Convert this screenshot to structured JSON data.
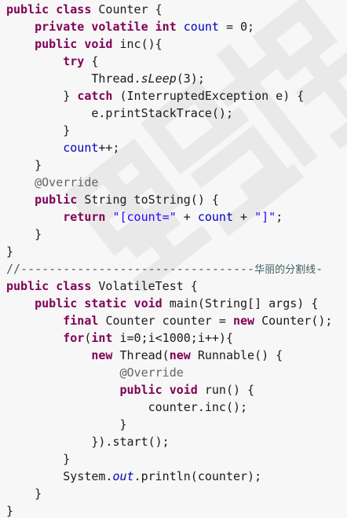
{
  "title": "",
  "watermark": "黑马程序员",
  "lines": [
    [
      {
        "t": "public class ",
        "c": "kw"
      },
      {
        "t": "Counter {"
      }
    ],
    [
      {
        "t": "    "
      },
      {
        "t": "private volatile int ",
        "c": "kw"
      },
      {
        "t": "count",
        "c": "fld"
      },
      {
        "t": " = 0;"
      }
    ],
    [
      {
        "t": "    "
      },
      {
        "t": "public void ",
        "c": "kw"
      },
      {
        "t": "inc(){"
      }
    ],
    [
      {
        "t": "        "
      },
      {
        "t": "try ",
        "c": "kw"
      },
      {
        "t": "{"
      }
    ],
    [
      {
        "t": "            Thread."
      },
      {
        "t": "sLeep",
        "c": "ital"
      },
      {
        "t": "(3);"
      }
    ],
    [
      {
        "t": "        } "
      },
      {
        "t": "catch ",
        "c": "kw"
      },
      {
        "t": "(InterruptedException e) {"
      }
    ],
    [
      {
        "t": "            e.printStackTrace();"
      }
    ],
    [
      {
        "t": "        }"
      }
    ],
    [
      {
        "t": "        "
      },
      {
        "t": "count",
        "c": "fld"
      },
      {
        "t": "++;"
      }
    ],
    [
      {
        "t": "    }"
      }
    ],
    [
      {
        "t": "    "
      },
      {
        "t": "@Override",
        "c": "ann"
      }
    ],
    [
      {
        "t": "    "
      },
      {
        "t": "public ",
        "c": "kw"
      },
      {
        "t": "String toString() {"
      }
    ],
    [
      {
        "t": "        "
      },
      {
        "t": "return ",
        "c": "kw"
      },
      {
        "t": "\"[count=\"",
        "c": "str"
      },
      {
        "t": " + "
      },
      {
        "t": "count",
        "c": "fld"
      },
      {
        "t": " + "
      },
      {
        "t": "\"]\"",
        "c": "str"
      },
      {
        "t": ";"
      }
    ],
    [
      {
        "t": "    }"
      }
    ],
    [
      {
        "t": "}"
      }
    ],
    [
      {
        "t": "//---------------------------------",
        "c": "cmt"
      },
      {
        "t": "华丽的分割线",
        "c": "cmt cjk"
      },
      {
        "t": "-",
        "c": "cmt"
      }
    ],
    [
      {
        "t": "public class ",
        "c": "kw"
      },
      {
        "t": "VolatileTest {"
      }
    ],
    [
      {
        "t": "    "
      },
      {
        "t": "public static void ",
        "c": "kw"
      },
      {
        "t": "main(String[] args) {"
      }
    ],
    [
      {
        "t": "        "
      },
      {
        "t": "final ",
        "c": "kw"
      },
      {
        "t": "Counter counter = "
      },
      {
        "t": "new ",
        "c": "kw"
      },
      {
        "t": "Counter();"
      }
    ],
    [
      {
        "t": "        "
      },
      {
        "t": "for",
        "c": "kw"
      },
      {
        "t": "("
      },
      {
        "t": "int ",
        "c": "kw"
      },
      {
        "t": "i=0;i<1000;i++){"
      }
    ],
    [
      {
        "t": "            "
      },
      {
        "t": "new ",
        "c": "kw"
      },
      {
        "t": "Thread("
      },
      {
        "t": "new ",
        "c": "kw"
      },
      {
        "t": "Runnable() {"
      }
    ],
    [
      {
        "t": "                "
      },
      {
        "t": "@Override",
        "c": "ann"
      }
    ],
    [
      {
        "t": "                "
      },
      {
        "t": "public void ",
        "c": "kw"
      },
      {
        "t": "run() {"
      }
    ],
    [
      {
        "t": "                    counter.inc();"
      }
    ],
    [
      {
        "t": "                }"
      }
    ],
    [
      {
        "t": "            }).start();"
      }
    ],
    [
      {
        "t": "        }"
      }
    ],
    [
      {
        "t": "        System."
      },
      {
        "t": "out",
        "c": "sfld"
      },
      {
        "t": ".println(counter);"
      }
    ],
    [
      {
        "t": "    }"
      }
    ],
    [
      {
        "t": "}"
      }
    ]
  ]
}
